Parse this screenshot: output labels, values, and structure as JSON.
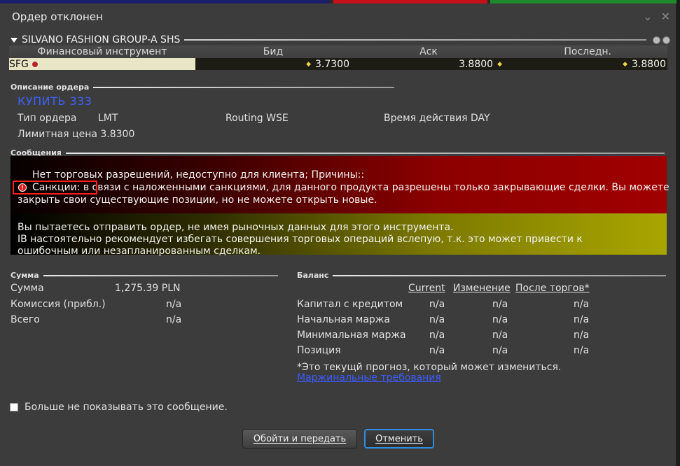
{
  "window": {
    "title": "Ордер отклонен"
  },
  "instrument": {
    "name": "SILVANO FASHION GROUP-A SHS",
    "columns": [
      "Финансовый инструмент",
      "Бид",
      "Аск",
      "Последн."
    ],
    "row": {
      "symbol": "SFG",
      "bid": "3.7300",
      "ask": "3.8800",
      "last": "3.8800"
    }
  },
  "order": {
    "section_title": "Описание ордера",
    "action": "КУПИТЬ 333",
    "type_label": "Тип ордера",
    "type_value": "LMT",
    "routing": "Routing WSE",
    "tif": "Время действия DAY",
    "limit_price": "Лимитная цена 3.8300"
  },
  "messages": {
    "section_title": "Сообщения",
    "red_line1": "Нет торговых разрешений, недоступно для клиента; Причины::",
    "red_line2": "Санкции: в связи с наложенными санкциями, для данного продукта разрешены только закрывающие сделки. Вы можете",
    "red_line3": "закрыть свои существующие позиции, но не можете открыть новые.",
    "yellow_line1": "Вы пытаетесь отправить ордер, не имея рыночных данных для этого инструмента.",
    "yellow_line2": "IB настоятельно рекомендует избегать совершения торговых операций вслепую, т.к. это может привести к",
    "yellow_line3": "ошибочным или незапланированным сделкам."
  },
  "sum": {
    "section_title": "Сумма",
    "rows": [
      {
        "label": "Сумма",
        "value": "1,275.39 PLN"
      },
      {
        "label": "Комиссия (прибл.)",
        "value": "n/a"
      },
      {
        "label": "Всего",
        "value": "n/a"
      }
    ]
  },
  "balance": {
    "section_title": "Баланс",
    "headers": [
      "Current",
      "Изменение",
      "После торгов*"
    ],
    "rows": [
      {
        "label": "Капитал с кредитом",
        "current": "n/a",
        "change": "n/a",
        "after": "n/a"
      },
      {
        "label": "Начальная маржа",
        "current": "n/a",
        "change": "n/a",
        "after": "n/a"
      },
      {
        "label": "Минимальная маржа",
        "current": "n/a",
        "change": "n/a",
        "after": "n/a"
      },
      {
        "label": "Позиция",
        "current": "n/a",
        "change": "n/a",
        "after": "n/a"
      }
    ],
    "note": "*Это текущй прогноз, который может измениться.",
    "margin_link": "Маржинальные требования"
  },
  "footer": {
    "dont_show": "Больше не показывать это сообщение.",
    "submit_label": "Обойти и передать",
    "cancel_label": "Отменить"
  },
  "icons": [
    "chevron-down-icon",
    "close-icon",
    "collapse-triangle-icon",
    "settings-icon",
    "info-icon",
    "instrument-flag-icon",
    "diamond-icon",
    "error-icon",
    "checkbox-icon"
  ],
  "colors": {
    "accent": "#2f8ee0",
    "link": "#3b5bff",
    "action": "#3b62ff",
    "error": "#a00000",
    "warning": "#a9a600"
  }
}
